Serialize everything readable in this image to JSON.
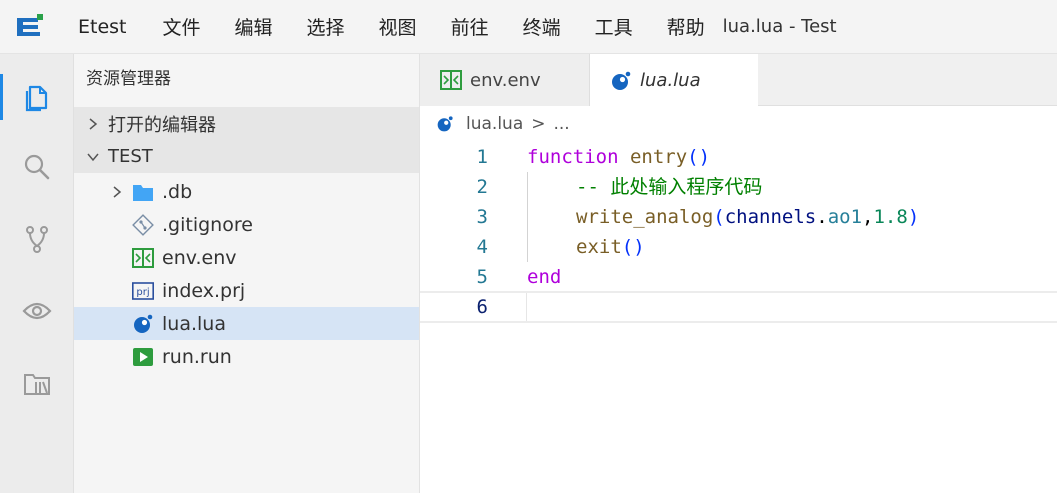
{
  "titlebar": {
    "app_name": "Etest",
    "menu": [
      "文件",
      "编辑",
      "选择",
      "视图",
      "前往",
      "终端",
      "工具",
      "帮助"
    ],
    "window_title": "lua.lua - Test"
  },
  "activity_bar": {
    "items": [
      {
        "icon": "explorer-icon",
        "active": true
      },
      {
        "icon": "search-icon",
        "active": false
      },
      {
        "icon": "source-control-icon",
        "active": false
      },
      {
        "icon": "eye-icon",
        "active": false
      },
      {
        "icon": "library-icon",
        "active": false
      }
    ]
  },
  "sidebar": {
    "title": "资源管理器",
    "open_editors": "打开的编辑器",
    "project": "TEST",
    "files": [
      {
        "name": ".db",
        "icon": "folder-icon",
        "expandable": true
      },
      {
        "name": ".gitignore",
        "icon": "git-icon"
      },
      {
        "name": "env.env",
        "icon": "env-file-icon"
      },
      {
        "name": "index.prj",
        "icon": "prj-file-icon"
      },
      {
        "name": "lua.lua",
        "icon": "lua-file-icon",
        "selected": true
      },
      {
        "name": "run.run",
        "icon": "run-file-icon"
      }
    ]
  },
  "editor": {
    "tabs": [
      {
        "label": "env.env",
        "icon": "env-file-icon",
        "active": false
      },
      {
        "label": "lua.lua",
        "icon": "lua-file-icon",
        "active": true
      }
    ],
    "breadcrumb": {
      "file": "lua.lua",
      "separator": ">",
      "more": "..."
    },
    "line_numbers": [
      "1",
      "2",
      "3",
      "4",
      "5",
      "6"
    ],
    "code": {
      "l1_kw": "function",
      "l1_fn": "entry",
      "l1_parens": "()",
      "l2_comment": "-- 此处输入程序代码",
      "l3_fn": "write_analog",
      "l3_open": "(",
      "l3_var": "channels",
      "l3_dot": ".",
      "l3_prop": "ao1",
      "l3_comma": ",",
      "l3_num": "1.8",
      "l3_close": ")",
      "l4_fn": "exit",
      "l4_parens": "()",
      "l5_kw": "end"
    }
  },
  "colors": {
    "accent": "#1e88e5",
    "keyword": "#af00db",
    "function": "#795e26",
    "comment": "#008000",
    "line_number": "#237893"
  }
}
